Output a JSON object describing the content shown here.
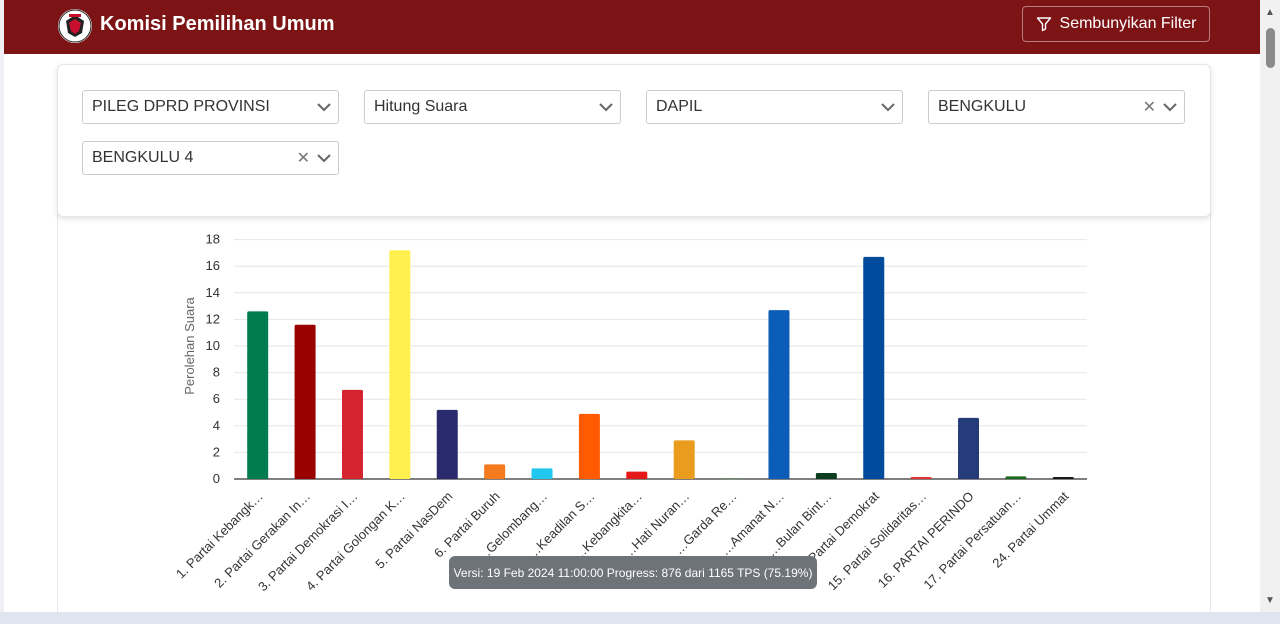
{
  "header": {
    "title": "Komisi Pemilihan Umum",
    "filter_button": "Sembunyikan Filter"
  },
  "filters": [
    {
      "value": "PILEG DPRD PROVINSI",
      "clearable": false
    },
    {
      "value": "Hitung Suara",
      "clearable": false
    },
    {
      "value": "DAPIL",
      "clearable": false
    },
    {
      "value": "BENGKULU",
      "clearable": true
    },
    {
      "value": "BENGKULU 4",
      "clearable": true
    }
  ],
  "tooltip": "Versi: 19 Feb 2024 11:00:00 Progress: 876 dari 1165 TPS (75.19%)",
  "chart_data": {
    "type": "bar",
    "ylabel": "Perolehan Suara",
    "ylim": [
      0,
      20
    ],
    "yticks": [
      0,
      2,
      4,
      6,
      8,
      10,
      12,
      14,
      16,
      18,
      20
    ],
    "grid": true,
    "categories": [
      "1. Partai Kebangk…",
      "2. Partai Gerakan In…",
      "3. Partai Demokrasi I…",
      "4. Partai Golongan K…",
      "5. Partai NasDem",
      "6. Partai Buruh",
      "7. …Gelombang…",
      "8. …Keadilan S…",
      "9. …Kebangkita…",
      "10. …Hati Nuran…",
      "11. …Garda Re…",
      "12. …Amanat N…",
      "13. …Bulan Bint…",
      "14. Partai Demokrat",
      "15. Partai Solidaritas…",
      "16. PARTAI PERINDO",
      "17. Partai Persatuan…",
      "24. Partai Ummat"
    ],
    "values": [
      12.6,
      11.6,
      6.7,
      17.2,
      5.2,
      1.1,
      0.8,
      4.9,
      0.55,
      2.9,
      0.05,
      12.7,
      0.45,
      16.7,
      0.15,
      4.6,
      0.2,
      0.15
    ],
    "colors": [
      "#007b4f",
      "#9a0000",
      "#d52330",
      "#fff04f",
      "#2a2a6e",
      "#f47a20",
      "#22c7f0",
      "#ff5a00",
      "#e61919",
      "#e99c1e",
      "#3d5a40",
      "#0b5db7",
      "#0b3d1e",
      "#004b9b",
      "#e8322f",
      "#263b7a",
      "#1b6b1b",
      "#1a1a1a"
    ]
  }
}
